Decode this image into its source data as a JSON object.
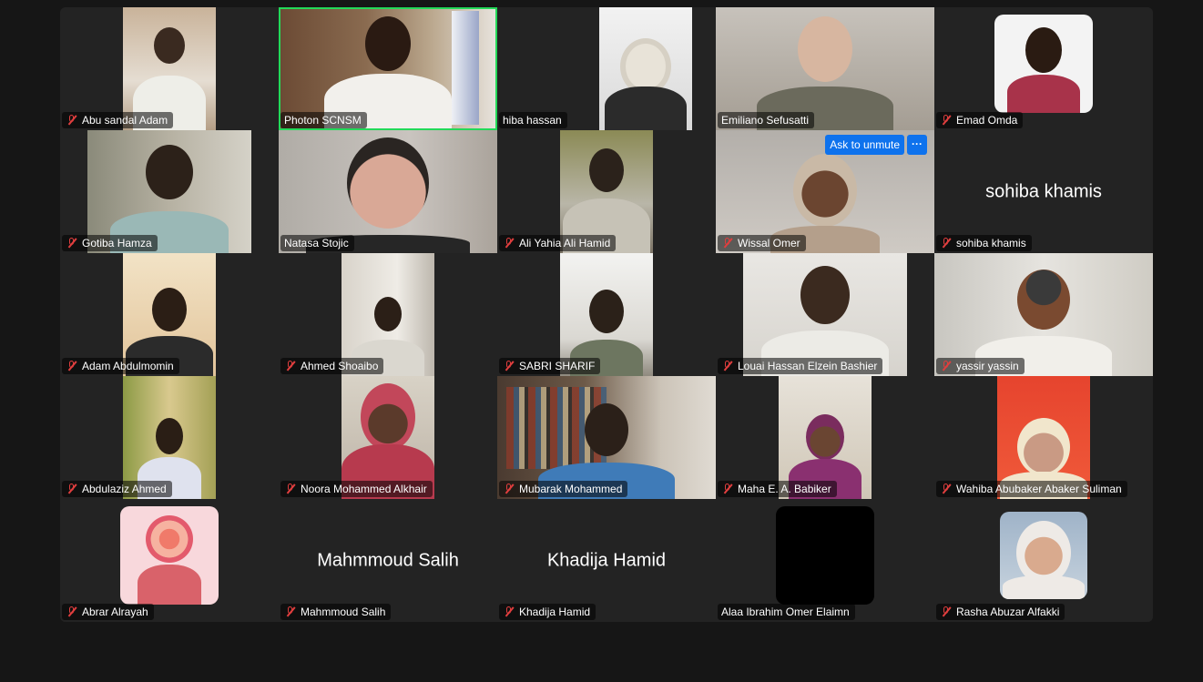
{
  "participants": [
    {
      "name": "Abu sandal Adam",
      "muted": true
    },
    {
      "name": "Photon SCNSM",
      "muted": false,
      "active": true
    },
    {
      "name": "hiba hassan",
      "muted": false
    },
    {
      "name": "Emiliano Sefusatti",
      "muted": false
    },
    {
      "name": "Emad Omda",
      "muted": true
    },
    {
      "name": "Gotiba Hamza",
      "muted": true
    },
    {
      "name": "Natasa Stojic",
      "muted": false
    },
    {
      "name": "Ali Yahia Ali Hamid",
      "muted": true
    },
    {
      "name": "Wissal Omer",
      "muted": true
    },
    {
      "name": "sohiba khamis",
      "muted": true,
      "center_label": "sohiba khamis"
    },
    {
      "name": "Adam Abdulmomin",
      "muted": true
    },
    {
      "name": "Ahmed Shoaibo",
      "muted": true
    },
    {
      "name": "SABRI SHARIF",
      "muted": true
    },
    {
      "name": "Louai Hassan Elzein Bashier",
      "muted": true
    },
    {
      "name": "yassir yassin",
      "muted": true
    },
    {
      "name": "Abdulaziz Ahmed",
      "muted": true
    },
    {
      "name": "Noora Mohammed Alkhair",
      "muted": true
    },
    {
      "name": "Mubarak Mohammed",
      "muted": true
    },
    {
      "name": "Maha E. A. Babiker",
      "muted": true
    },
    {
      "name": "Wahiba Abubaker Abaker Suliman",
      "muted": true
    },
    {
      "name": "Abrar Alrayah",
      "muted": true
    },
    {
      "name": "Mahmmoud Salih",
      "muted": true,
      "center_label": "Mahmmoud Salih"
    },
    {
      "name": "Khadija Hamid",
      "muted": true,
      "center_label": "Khadija Hamid"
    },
    {
      "name": "Alaa Ibrahim Omer Elaimn",
      "muted": false
    },
    {
      "name": "Rasha Abuzar Alfakki",
      "muted": true
    }
  ],
  "controls": {
    "ask_to_unmute": "Ask to unmute",
    "more_options": "···"
  },
  "colors": {
    "active_speaker": "#23d959",
    "muted_icon": "#e03e3e",
    "button_blue": "#0e72ed"
  }
}
